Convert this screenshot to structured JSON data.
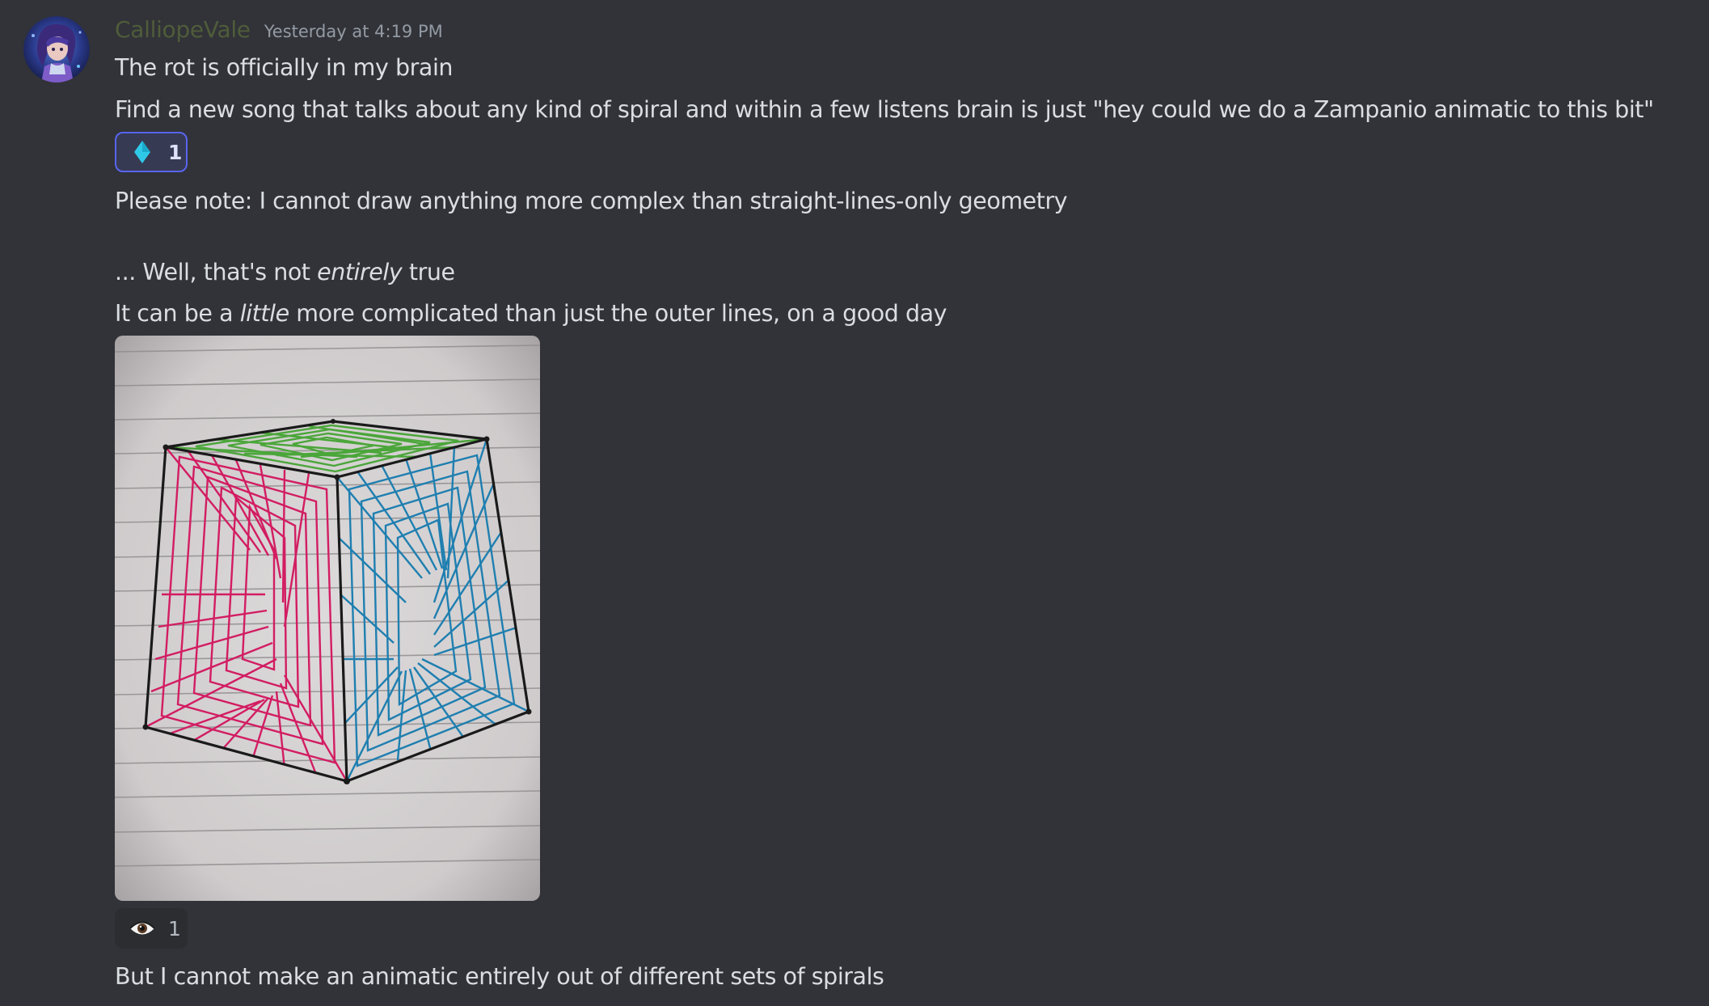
{
  "message": {
    "author": "CalliopeVale",
    "timestamp": "Yesterday at 4:19 PM",
    "lines": {
      "l1": "The rot is officially in my brain",
      "l2": "Find a new song that talks about any kind of spiral and within a few listens brain is just \"hey could we do a Zampanio animatic to this bit\"",
      "l3": "Please note: I cannot draw anything more complex than straight-lines-only geometry",
      "l4_a": "... Well, that's not ",
      "l4_em": "entirely",
      "l4_b": " true",
      "l5_a": "It can be a ",
      "l5_em": "little",
      "l5_b": " more complicated than just the outer lines, on a good day",
      "l6": "But I cannot make an animatic entirely out of different sets of spirals"
    },
    "reactions": [
      {
        "emoji": "diamond-icon",
        "count": "1",
        "color": "#2fc8e8",
        "active": true
      },
      {
        "emoji": "eye-icon",
        "count": "1",
        "active": false
      }
    ],
    "attachment": {
      "kind": "photo",
      "subject": "hand-drawn cube with spiral line shading on lined paper",
      "colors": {
        "paper": "#d6d3d4",
        "left_face": "#d21d62",
        "right_face": "#1f7fb0",
        "top_face": "#4ba63a",
        "outline": "#1a1a1a"
      }
    }
  },
  "theme": {
    "background": "#313338",
    "text": "#dbdee1",
    "muted": "#949ba4",
    "author_color": "#4f5c3a",
    "reaction_active_border": "#5865f2"
  }
}
